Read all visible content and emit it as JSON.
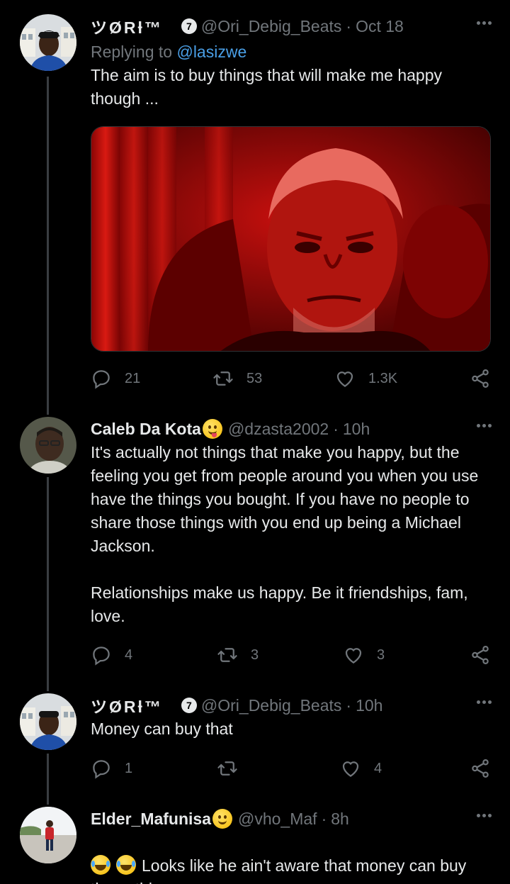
{
  "tweets": [
    {
      "name": "ツØRƚ™",
      "badge": "7",
      "handle": "@Ori_Debig_Beats",
      "time": "Oct 18",
      "replying_label": "Replying to",
      "replying_handle": "@lasizwe",
      "text": "The aim is to buy things that will make me happy though ...",
      "replies": "21",
      "retweets": "53",
      "likes": "1.3K"
    },
    {
      "name": "Caleb Da Kota",
      "handle": "@dzasta2002",
      "time": "10h",
      "text": "It's actually not things that make you happy, but the feeling you get from people around you when you use have the things you bought. If you have no people to share those things with you end up being a Michael Jackson.\n\nRelationships make us happy. Be it friendships, fam, love.",
      "replies": "4",
      "retweets": "3",
      "likes": "3"
    },
    {
      "name": "ツØRƚ™",
      "badge": "7",
      "handle": "@Ori_Debig_Beats",
      "time": "10h",
      "text": "Money can buy that",
      "replies": "1",
      "retweets": "",
      "likes": "4"
    },
    {
      "name": "Elder_Mafunisa",
      "handle": "@vho_Maf",
      "time": "8h",
      "text": "Looks like he ain't aware that money can buy these things."
    }
  ],
  "separator": "·",
  "icons": {
    "reply": "reply-icon",
    "retweet": "retweet-icon",
    "like": "heart-icon",
    "share": "share-icon",
    "more": "more-icon"
  },
  "colors": {
    "background": "#000000",
    "text": "#e7e9ea",
    "muted": "#71767b",
    "link": "#4a9fe6"
  }
}
